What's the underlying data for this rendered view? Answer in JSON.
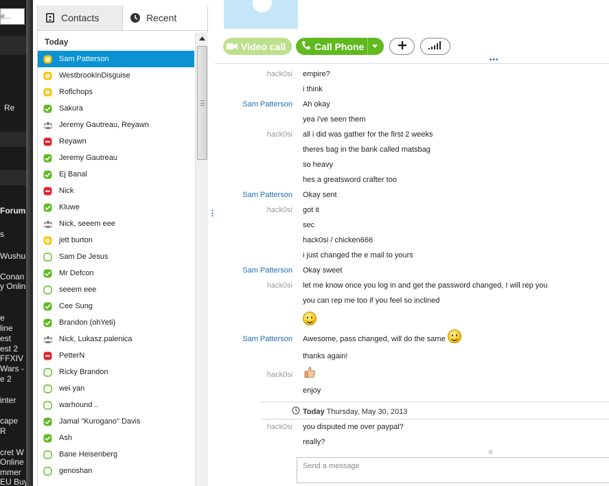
{
  "background": {
    "search_text": "e...",
    "fragments": [
      "Re",
      "Forum",
      "s",
      "Wushu",
      "Conan",
      "y Onlin",
      "e",
      "line",
      "est",
      "est 2",
      "FFXIV",
      "Wars -",
      "e 2",
      "inter",
      "cape",
      "R",
      "cret W",
      "Online",
      "mmer",
      "EU Buy"
    ]
  },
  "tabs": {
    "contacts_label": "Contacts",
    "recent_label": "Recent"
  },
  "list_header": "Today",
  "contacts": [
    {
      "name": "Sam Patterson",
      "status": "away",
      "selected": true
    },
    {
      "name": "WestbrookInDisguise",
      "status": "away"
    },
    {
      "name": "Roflchops",
      "status": "away"
    },
    {
      "name": "Sakura",
      "status": "online"
    },
    {
      "name": "Jeremy Gautreau, Reyawn",
      "status": "group"
    },
    {
      "name": "Reyawn",
      "status": "busy"
    },
    {
      "name": "Jeremy Gautreau",
      "status": "online"
    },
    {
      "name": "Ej Banal",
      "status": "online"
    },
    {
      "name": "Nick",
      "status": "busy"
    },
    {
      "name": "Kluwe",
      "status": "online"
    },
    {
      "name": "Nick, seeem eee",
      "status": "group"
    },
    {
      "name": "jett burton",
      "status": "away"
    },
    {
      "name": "Sam De Jesus",
      "status": "offline"
    },
    {
      "name": "Mr Defcon",
      "status": "online"
    },
    {
      "name": "seeem eee",
      "status": "offline"
    },
    {
      "name": "Cee Sung",
      "status": "online"
    },
    {
      "name": "Brandon (ohYeti)",
      "status": "online"
    },
    {
      "name": "Nick, Lukasz.palenica",
      "status": "group"
    },
    {
      "name": "PetterN",
      "status": "busy"
    },
    {
      "name": "Ricky Brandon",
      "status": "offline"
    },
    {
      "name": "wei yan",
      "status": "offline"
    },
    {
      "name": "warhound ..",
      "status": "offline"
    },
    {
      "name": "Jamal \"Kurogano\" Davis",
      "status": "online"
    },
    {
      "name": "Ash",
      "status": "online"
    },
    {
      "name": "Bane Heisenberg",
      "status": "offline"
    },
    {
      "name": "genoshan",
      "status": "offline"
    }
  ],
  "toolbar": {
    "video_call_label": "Video call",
    "call_phone_label": "Call Phone"
  },
  "messages": [
    {
      "sender": "hack0si",
      "self": true,
      "text": "empire?"
    },
    {
      "sender": "",
      "self": true,
      "text": "i think"
    },
    {
      "sender": "Sam Patterson",
      "self": false,
      "text": "Ah okay"
    },
    {
      "sender": "",
      "self": false,
      "text": "yea i've seen them"
    },
    {
      "sender": "hack0si",
      "self": true,
      "text": "all i did was gather for the first 2 weeks"
    },
    {
      "sender": "",
      "self": true,
      "text": "theres bag in the bank called matsbag"
    },
    {
      "sender": "",
      "self": true,
      "text": "so heavy"
    },
    {
      "sender": "",
      "self": true,
      "text": "hes a greatsword crafter too"
    },
    {
      "sender": "Sam Patterson",
      "self": false,
      "text": "Okay sent"
    },
    {
      "sender": "hack0si",
      "self": true,
      "text": "got it"
    },
    {
      "sender": "",
      "self": true,
      "text": "sec"
    },
    {
      "sender": "",
      "self": true,
      "text": "hack0si / chicken666"
    },
    {
      "sender": "",
      "self": true,
      "text": "i just changed the e mail to yours"
    },
    {
      "sender": "Sam Patterson",
      "self": false,
      "text": "Okay sweet"
    },
    {
      "sender": "hack0si",
      "self": true,
      "text": "let me know once you log in and get the password changed, I will rep you"
    },
    {
      "sender": "",
      "self": true,
      "text": "you can rep me too if you feel so inclined"
    },
    {
      "sender": "",
      "self": true,
      "text": "",
      "emoticon": "smile"
    },
    {
      "sender": "Sam Patterson",
      "self": false,
      "text": "Awesome, pass changed, will do the same",
      "emoticon": "smile"
    },
    {
      "sender": "",
      "self": false,
      "text": "thanks again!"
    },
    {
      "sender": "hack0si",
      "self": true,
      "text": "",
      "emoticon": "thumbs-up"
    },
    {
      "sender": "",
      "self": true,
      "text": "enjoy"
    }
  ],
  "day_separator": {
    "label": "Today",
    "date": "Thursday, May 30, 2013"
  },
  "messages_today": [
    {
      "sender": "hack0si",
      "self": true,
      "text": "you disputed me over paypal?"
    },
    {
      "sender": "",
      "self": true,
      "text": "really?"
    }
  ],
  "composer": {
    "placeholder": "Send a message"
  },
  "colors": {
    "accent_blue": "#0a92d2",
    "call_green": "#5fb91f",
    "video_green_disabled": "#bde08d",
    "status_online": "#5fb91f",
    "status_away": "#f7c600",
    "status_busy": "#e0232c"
  }
}
